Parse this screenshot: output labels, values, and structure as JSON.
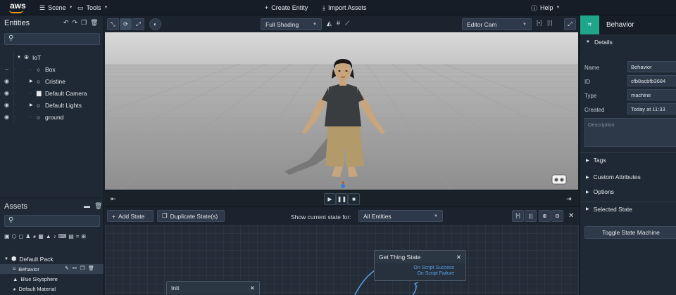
{
  "topbar": {
    "logo": "aws",
    "scene_menu": "Scene",
    "tools_menu": "Tools",
    "create_entity": "Create Entity",
    "import_assets": "Import Assets",
    "help_menu": "Help"
  },
  "entities": {
    "title": "Entities",
    "tree": [
      {
        "label": "IoT",
        "depth": 0,
        "expanded": true
      },
      {
        "label": "Box",
        "depth": 1
      },
      {
        "label": "Cristine",
        "depth": 1,
        "collapsed": true
      },
      {
        "label": "Default Camera",
        "depth": 1
      },
      {
        "label": "Default Lights",
        "depth": 1,
        "collapsed": true
      },
      {
        "label": "ground",
        "depth": 1
      }
    ]
  },
  "assets": {
    "title": "Assets",
    "pack": "Default Pack",
    "items": [
      "Behavior",
      "Blue Skysphere",
      "Default Material"
    ]
  },
  "viewport_toolbar": {
    "shading": "Full Shading",
    "camera": "Editor Cam"
  },
  "state_machine": {
    "add_state": "Add State",
    "duplicate_state": "Duplicate State(s)",
    "show_label": "Show current state for:",
    "show_value": "All Entities",
    "nodes": {
      "get_thing_state": {
        "title": "Get Thing State",
        "transitions": [
          "On Script Success",
          "On Script Failure"
        ]
      },
      "init": {
        "title": "Init"
      }
    }
  },
  "inspector": {
    "title": "Behavior",
    "details_section": "Details",
    "fields": {
      "name_label": "Name",
      "name_value": "Behavior",
      "id_label": "ID",
      "id_value": "cfb8acbfb3684",
      "type_label": "Type",
      "type_value": "machine",
      "created_label": "Created",
      "created_value": "Today at 11:33"
    },
    "description_placeholder": "Description",
    "sections": [
      "Tags",
      "Custom Attributes",
      "Options",
      "Selected State"
    ],
    "toggle_button": "Toggle State Machine"
  },
  "colors": {
    "accent_teal": "#1ea58a",
    "link_blue": "#5aa0e6",
    "background": "#1b232e"
  }
}
